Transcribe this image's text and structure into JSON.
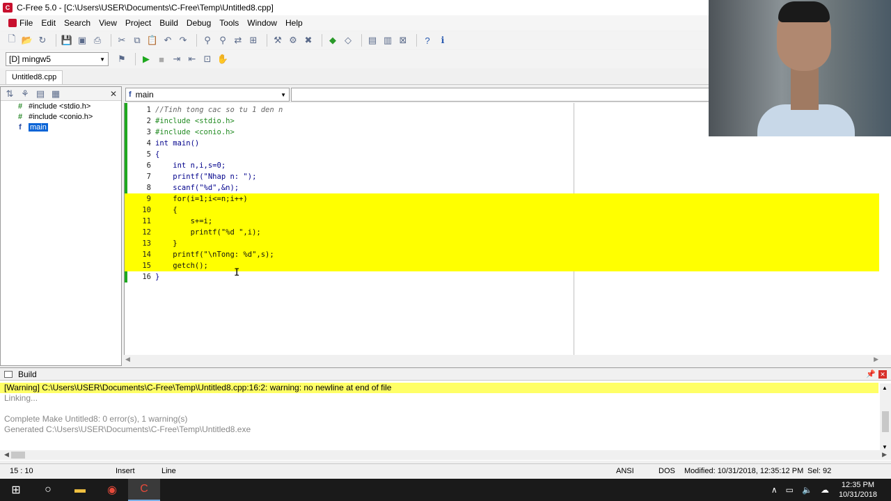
{
  "window": {
    "title": "C-Free 5.0 - [C:\\Users\\USER\\Documents\\C-Free\\Temp\\Untitled8.cpp]"
  },
  "menu": [
    "File",
    "Edit",
    "Search",
    "View",
    "Project",
    "Build",
    "Debug",
    "Tools",
    "Window",
    "Help"
  ],
  "toolbar2": {
    "compiler": "[D] mingw5"
  },
  "file_tab": "Untitled8.cpp",
  "tree": {
    "items": [
      {
        "label": "#include <stdio.h>",
        "icon": "hash-icon"
      },
      {
        "label": "#include <conio.h>",
        "icon": "hash-icon"
      },
      {
        "label": "main",
        "icon": "function-icon"
      }
    ]
  },
  "editor": {
    "function_combo": "main",
    "lines": [
      {
        "n": "1",
        "code": "//Tinh tong cac so tu 1 den n",
        "kind": "comment"
      },
      {
        "n": "2",
        "code": "#include <stdio.h>",
        "kind": "pre"
      },
      {
        "n": "3",
        "code": "#include <conio.h>",
        "kind": "pre"
      },
      {
        "n": "4",
        "code": "int main()",
        "kind": "kw"
      },
      {
        "n": "5",
        "code": "{",
        "kind": "kw"
      },
      {
        "n": "6",
        "code": "    int n,i,s=0;",
        "kind": "kw"
      },
      {
        "n": "7",
        "code": "    printf(\"Nhap n: \");",
        "kind": "kw"
      },
      {
        "n": "8",
        "code": "    scanf(\"%d\",&n);",
        "kind": "kw"
      },
      {
        "n": "9",
        "code": "    for(i=1;i<=n;i++)",
        "kind": "hl"
      },
      {
        "n": "10",
        "code": "    {",
        "kind": "hl"
      },
      {
        "n": "11",
        "code": "        s+=i;",
        "kind": "hl"
      },
      {
        "n": "12",
        "code": "        printf(\"%d \",i);",
        "kind": "hl"
      },
      {
        "n": "13",
        "code": "    }",
        "kind": "hl"
      },
      {
        "n": "14",
        "code": "    printf(\"\\nTong: %d\",s);",
        "kind": "hl"
      },
      {
        "n": "15",
        "code": "    getch();",
        "kind": "hl"
      },
      {
        "n": "16",
        "code": "}",
        "kind": "kw"
      }
    ]
  },
  "build": {
    "title": "Build",
    "lines": [
      {
        "text": "[Warning] C:\\Users\\USER\\Documents\\C-Free\\Temp\\Untitled8.cpp:16:2: warning: no newline at end of file",
        "kind": "warn"
      },
      {
        "text": "Linking...",
        "kind": "gray"
      },
      {
        "text": "",
        "kind": "blank"
      },
      {
        "text": "Complete Make Untitled8: 0 error(s), 1 warning(s)",
        "kind": "gray"
      },
      {
        "text": "Generated C:\\Users\\USER\\Documents\\C-Free\\Temp\\Untitled8.exe",
        "kind": "gray"
      }
    ]
  },
  "status": {
    "position": "15 : 10",
    "mode": "Insert",
    "selmode": "Line",
    "encoding": "ANSI",
    "eol": "DOS",
    "modified": "Modified: 10/31/2018, 12:35:12 PM",
    "sel": "Sel: 92"
  },
  "taskbar": {
    "time": "12:35 PM",
    "date": "10/31/2018"
  }
}
